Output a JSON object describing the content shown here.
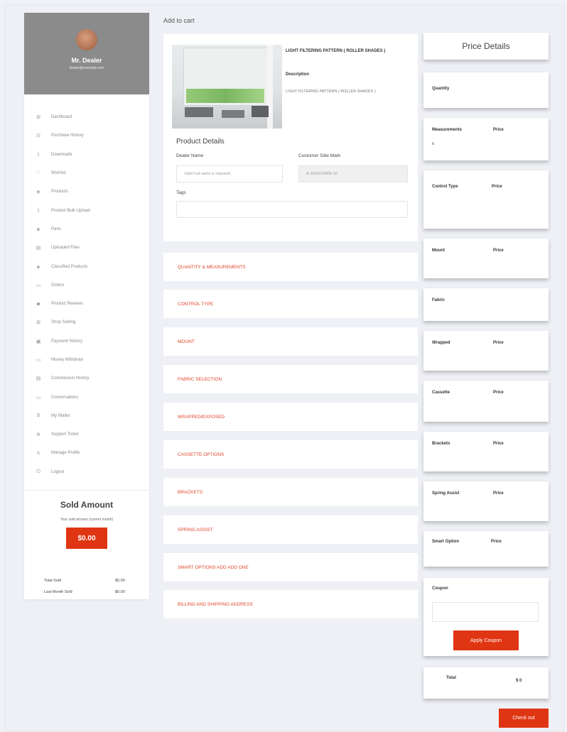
{
  "breadcrumb": "Add to cart",
  "profile": {
    "name": "Mr. Dealer",
    "email": "dealer@example.com"
  },
  "menu": [
    {
      "icon": "dashboard-icon",
      "glyph": "⊞",
      "label": "Dashboard"
    },
    {
      "icon": "history-icon",
      "glyph": "☰",
      "label": "Purchase History"
    },
    {
      "icon": "download-icon",
      "glyph": "⇩",
      "label": "Downloads"
    },
    {
      "icon": "heart-icon",
      "glyph": "♡",
      "label": "Wishlist"
    },
    {
      "icon": "products-icon",
      "glyph": "◈",
      "label": "Products"
    },
    {
      "icon": "upload-icon",
      "glyph": "⇧",
      "label": "Product Bulk Upload"
    },
    {
      "icon": "parts-icon",
      "glyph": "◈",
      "label": "Parts"
    },
    {
      "icon": "folder-icon",
      "glyph": "▤",
      "label": "Uploaded Files"
    },
    {
      "icon": "classified-icon",
      "glyph": "◈",
      "label": "Classified Products"
    },
    {
      "icon": "orders-icon",
      "glyph": "▭",
      "label": "Orders"
    },
    {
      "icon": "review-icon",
      "glyph": "◆",
      "label": "Product Reviews"
    },
    {
      "icon": "shop-icon",
      "glyph": "⊞",
      "label": "Shop Setting"
    },
    {
      "icon": "payment-icon",
      "glyph": "▣",
      "label": "Payment History"
    },
    {
      "icon": "withdraw-icon",
      "glyph": "▭",
      "label": "Money Withdraw"
    },
    {
      "icon": "commission-icon",
      "glyph": "▤",
      "label": "Commission History"
    },
    {
      "icon": "chat-icon",
      "glyph": "▭",
      "label": "Conversations"
    },
    {
      "icon": "wallet-icon",
      "glyph": "$",
      "label": "My Wallet"
    },
    {
      "icon": "ticket-icon",
      "glyph": "⊕",
      "label": "Support Ticket"
    },
    {
      "icon": "user-icon",
      "glyph": "♙",
      "label": "Manage Profile"
    },
    {
      "icon": "logout-icon",
      "glyph": "⏻",
      "label": "Logout"
    }
  ],
  "sold": {
    "title": "Sold Amount",
    "subtitle": "Your sold amount (current month)",
    "amount": "$0.00",
    "total_label": "Total Sold",
    "total_value": "$0.00",
    "last_label": "Last Month Sold",
    "last_value": "$0.00"
  },
  "product": {
    "title": "LIGHT FILTERING PATTERN ( ROLLER SHADES )",
    "description_label": "Description",
    "description": "LIGHT FILTERING PATTERN ( ROLLER SHADES )"
  },
  "details": {
    "heading": "Product Details",
    "dealer_label": "Dealer Name",
    "dealer_placeholder": "Valid Full name is required.",
    "customer_label": "Customer Side Mark",
    "customer_value": "A-1662215906-16",
    "tags_label": "Tags"
  },
  "accordion": [
    "QUANTITY & MEASUREMENTS",
    "CONTROL TYPE",
    "MOUNT",
    "FABRIC SELECTION",
    "WRAPPED/EXPOSED",
    "CASSETTE OPTIONS",
    "BRACKETS",
    "SPRING ASSIST",
    "SMART OPTIONS ADD ADD ONE",
    "BILLING AND SHIPPING ADDRESS"
  ],
  "price": {
    "heading": "Price Details",
    "price_label": "Price",
    "quantity": "Quantity",
    "measurements": "Measurements",
    "measurements_value": "x",
    "control_type": "Control Type",
    "mount": "Mount",
    "fabric": "Fabric",
    "wrapped": "Wrapped",
    "cassette": "Cassette",
    "brackets": "Brackets",
    "spring_assist": "Spring Assist",
    "smart_option": "Smart Option",
    "coupon": "Coupon",
    "apply_coupon": "Apply Coupon",
    "total_label": "Total",
    "total_value": "$ 0"
  },
  "checkout_label": "Check out",
  "colors": {
    "accent": "#e03512",
    "accordion_text": "#e0452a",
    "profile_bg": "#8b8b8b"
  }
}
